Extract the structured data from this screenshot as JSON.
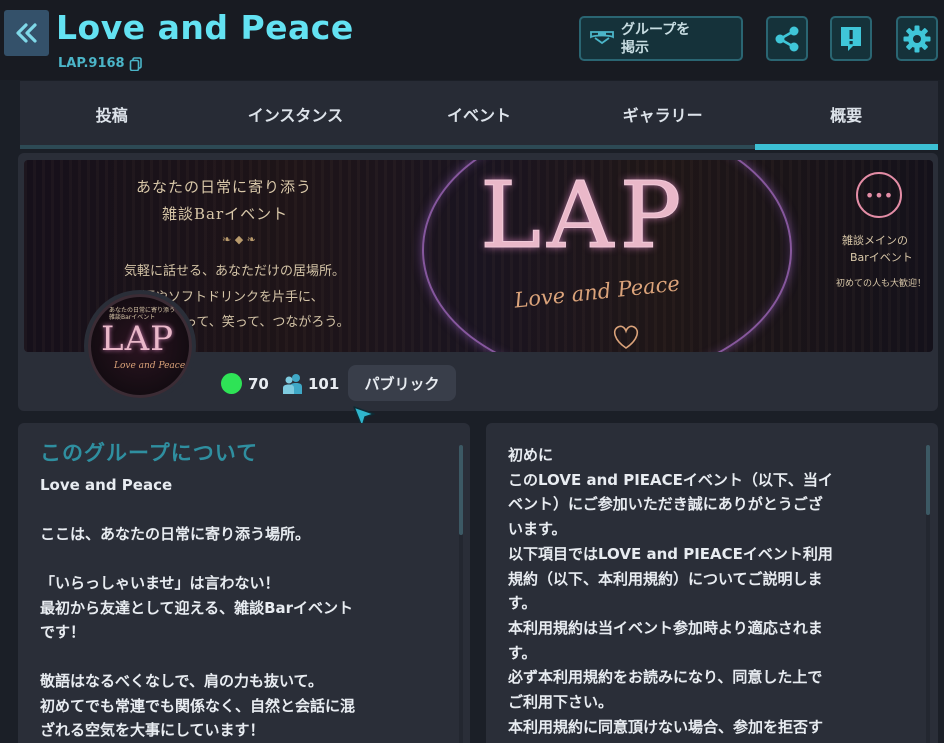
{
  "header": {
    "title": "Love and Peace",
    "group_code": "LAP.9168",
    "post_button_label": "グループを\n掲示",
    "icons": [
      "back-icon",
      "share-icon",
      "report-icon",
      "settings-icon"
    ]
  },
  "tabs": [
    {
      "label": "投稿"
    },
    {
      "label": "インスタンス"
    },
    {
      "label": "イベント"
    },
    {
      "label": "ギャラリー"
    },
    {
      "label": "概要",
      "active": true
    }
  ],
  "banner": {
    "left_lines": [
      "あなたの日常に寄り添う",
      "雑談Barイベント",
      "気軽に話せる、あなただけの居場所。",
      "酒やソフトドリンクを片手に、",
      "って、笑って、つながろう。"
    ],
    "logo_text": "LAP",
    "logo_script": "Love and Peace",
    "right_lines": [
      "雑談メインの",
      "Barイベント",
      "初めての人も大歓迎！"
    ]
  },
  "avatar": {
    "top_text": "あなたの日常に寄り添う 雑談Barイベント",
    "logo_text": "LAP",
    "script_text": "Love and Peace"
  },
  "stats": {
    "online": "70",
    "members": "101",
    "visibility": "パブリック"
  },
  "about": {
    "heading": "このグループについて",
    "lines": [
      "Love and Peace",
      "",
      "ここは、あなたの日常に寄り添う場所。",
      "",
      "「いらっしゃいませ」は言わない！",
      "最初から友達として迎える、雑談Barイベント",
      "です！",
      "",
      "敬語はなるべくなしで、肩の力も抜いて。",
      "初めてでも常連でも関係なく、自然と会話に混",
      "ざれる空気を大事にしています！"
    ]
  },
  "rules": {
    "lines": [
      "初めに",
      "このLOVE and PIEACEイベント（以下、当イ",
      "ベント）にご参加いただき誠にありがとうござ",
      "います。",
      "以下項目ではLOVE and PIEACEイベント利用",
      "規約（以下、本利用規約）についてご説明しま",
      "す。",
      "本利用規約は当イベント参加時より適応されま",
      "す。",
      "必ず本利用規約をお読みになり、同意した上で",
      "ご利用下さい。",
      "本利用規約に同意頂けない場合、参加を拒否す"
    ]
  },
  "colors": {
    "accent": "#63e2f2",
    "online": "#2ee356",
    "background": "#1b1f27",
    "panel": "#2a2e38"
  }
}
